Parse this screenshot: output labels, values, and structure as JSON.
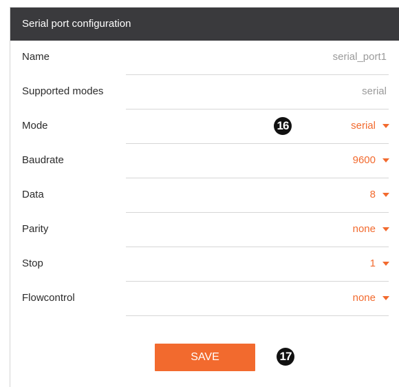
{
  "panel": {
    "title": "Serial port configuration"
  },
  "fields": {
    "name": {
      "label": "Name",
      "value": "serial_port1"
    },
    "supported_modes": {
      "label": "Supported modes",
      "value": "serial"
    },
    "mode": {
      "label": "Mode",
      "value": "serial"
    },
    "baudrate": {
      "label": "Baudrate",
      "value": "9600"
    },
    "data": {
      "label": "Data",
      "value": "8"
    },
    "parity": {
      "label": "Parity",
      "value": "none"
    },
    "stop": {
      "label": "Stop",
      "value": "1"
    },
    "flowcontrol": {
      "label": "Flowcontrol",
      "value": "none"
    }
  },
  "callouts": {
    "mode_marker": "16",
    "save_marker": "17"
  },
  "actions": {
    "save_label": "SAVE"
  },
  "colors": {
    "header_bg": "#3a3a3d",
    "accent": "#f26a2e",
    "static_value": "#9a9a9a"
  },
  "icons": {
    "dropdown": "caret-down-icon"
  }
}
